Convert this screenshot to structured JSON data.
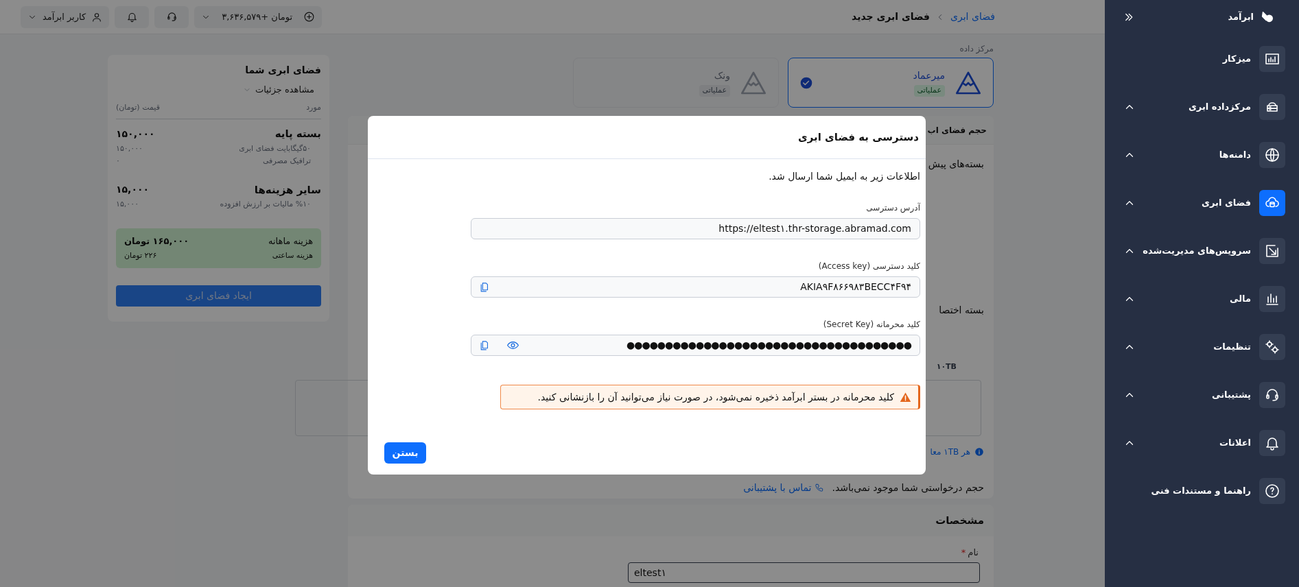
{
  "topbar": {
    "breadcrumb": [
      {
        "label": "فضای ابری",
        "kind": "link"
      },
      {
        "label": "فضای ابری جدید",
        "kind": "current"
      }
    ],
    "balance": "۳,۶۳۶,۵۷۹+ تومان",
    "user": "کاربر ابرآمد"
  },
  "sidebar": {
    "brand": "ابرآمد",
    "items": [
      {
        "label": "میزکار",
        "expandable": false,
        "selected": false
      },
      {
        "label": "مرکزداده ابری",
        "expandable": true,
        "selected": false
      },
      {
        "label": "دامنه‌ها",
        "expandable": true,
        "selected": false
      },
      {
        "label": "فضای ابری",
        "expandable": true,
        "selected": true
      },
      {
        "label": "سرویس‌های مدیریت‌شده",
        "expandable": true,
        "selected": false
      },
      {
        "label": "مالی",
        "expandable": true,
        "selected": false
      },
      {
        "label": "تنظیمات",
        "expandable": true,
        "selected": false
      },
      {
        "label": "پشتیبانی",
        "expandable": true,
        "selected": false
      },
      {
        "label": "اعلانات",
        "expandable": true,
        "selected": false
      },
      {
        "label": "راهنما و مستندات فنی",
        "expandable": false,
        "selected": false
      }
    ]
  },
  "datacenter": {
    "label": "مرکز داده",
    "options": [
      {
        "name": "میرعماد",
        "status": "عملیاتی",
        "selected": true
      },
      {
        "name": "ونک",
        "status": "عملیاتی",
        "selected": false
      }
    ]
  },
  "size_panel": {
    "title": "حجم فضای اب",
    "packages_label": "بسته‌های پیش",
    "custom_label": "بسته اختصا",
    "tick": "۱۰TB",
    "note": "هر ۱TB معا",
    "unavailable": "حجم درخواستی شما موجود نمی‌باشد.",
    "support_link": "تماس با پشتیبانی"
  },
  "specs_panel": {
    "title": "مشخصات",
    "name_label": "نام",
    "required_mark": "*",
    "name_value": "eltest۱"
  },
  "summary": {
    "title": "فضای ابری شما",
    "toggle": "مشاهده جزئیات",
    "columns": [
      "مورد",
      "قیمت (تومان)"
    ],
    "groups": [
      {
        "title": "بسته پایه",
        "amount": "۱۵۰,۰۰۰",
        "lines": [
          {
            "label": "۵۰گیگابایت فضای ابری",
            "value": "۱۵۰,۰۰۰"
          },
          {
            "label": "ترافیک مصرفی",
            "value": "۰"
          }
        ]
      },
      {
        "title": "سایر هزینه‌ها",
        "amount": "۱۵,۰۰۰",
        "lines": [
          {
            "label": "%۱۰ مالیات بر ارزش افزوده",
            "value": "۱۵,۰۰۰"
          }
        ]
      }
    ],
    "monthly_label": "هزینه ماهانه",
    "monthly_value": "۱۶۵,۰۰۰ تومان",
    "hourly_label": "هزینه ساعتی",
    "hourly_value": "۲۲۶ تومان",
    "button": "ایجاد فضای ابری"
  },
  "modal": {
    "title": "دسترسی به فضای ابری",
    "message": "اطلاعات زیر به ایمیل شما ارسال شد.",
    "fields": [
      {
        "kind": "text",
        "label": "آدرس دسترسی",
        "value": "https://eltest۱.thr-storage.abramad.com"
      },
      {
        "kind": "copy",
        "label": "کلید دسترسی (Access key)",
        "value": "AKIA۹F۸۶۶۹۸۳BECC۴F۹۴"
      },
      {
        "kind": "secret",
        "label": "کلید محرمانه (Secret Key)",
        "value": "●●●●●●●●●●●●●●●●●●●●●●●●●●●●●●●●●●●●●"
      }
    ],
    "warning": "کلید محرمانه در بستر ابرآمد ذخیره نمی‌شود، در صورت نیاز می‌توانید آن را بازنشانی کنید.",
    "button": "بستن"
  }
}
